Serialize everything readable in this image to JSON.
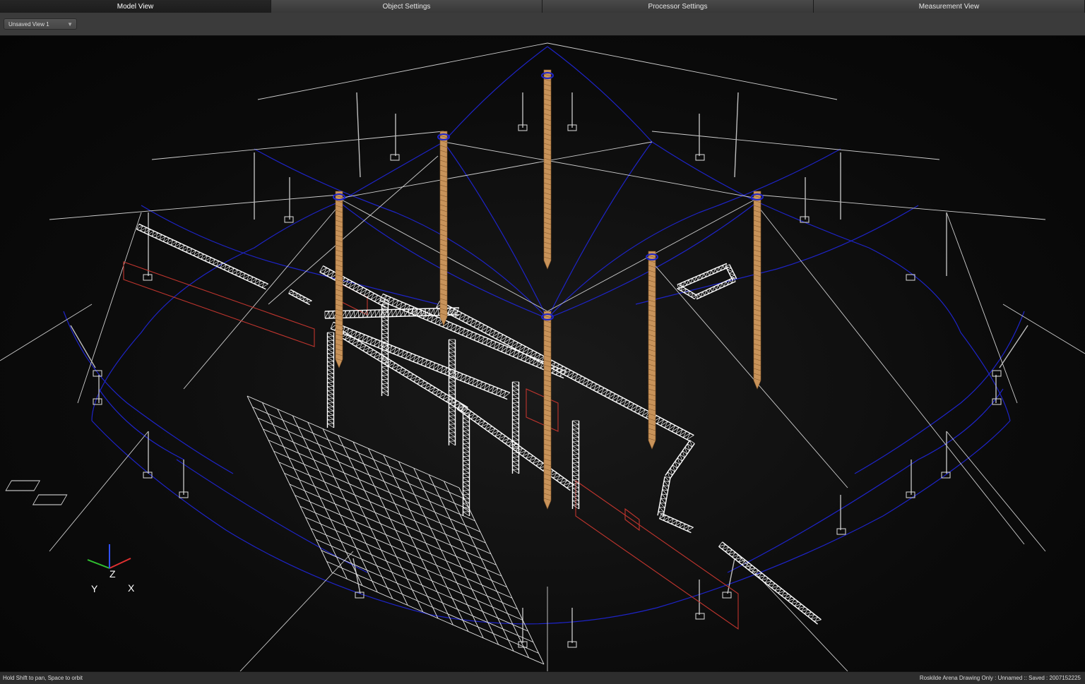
{
  "tabs": [
    {
      "label": "Model View",
      "active": true
    },
    {
      "label": "Object Settings",
      "active": false
    },
    {
      "label": "Processor Settings",
      "active": false
    },
    {
      "label": "Measurement View",
      "active": false
    }
  ],
  "toolbar": {
    "view_select_value": "Unsaved View 1",
    "dropdown_icon": "chevron-down-icon"
  },
  "viewport": {
    "background": "#000000",
    "cable_color": "#1e24c8",
    "truss_color": "#ffffff",
    "mast_color": "#c8935a",
    "speaker_color": "#c0352e"
  },
  "axis_gizmo": {
    "x_label": "X",
    "y_label": "Y",
    "z_label": "Z",
    "x_color": "#e03030",
    "y_color": "#30c030",
    "z_color": "#3050ff"
  },
  "status": {
    "hint": "Hold Shift to pan, Space to orbit",
    "document": "Roskilde Arena Drawing Only : Unnamed :: Saved : 2007152225"
  }
}
